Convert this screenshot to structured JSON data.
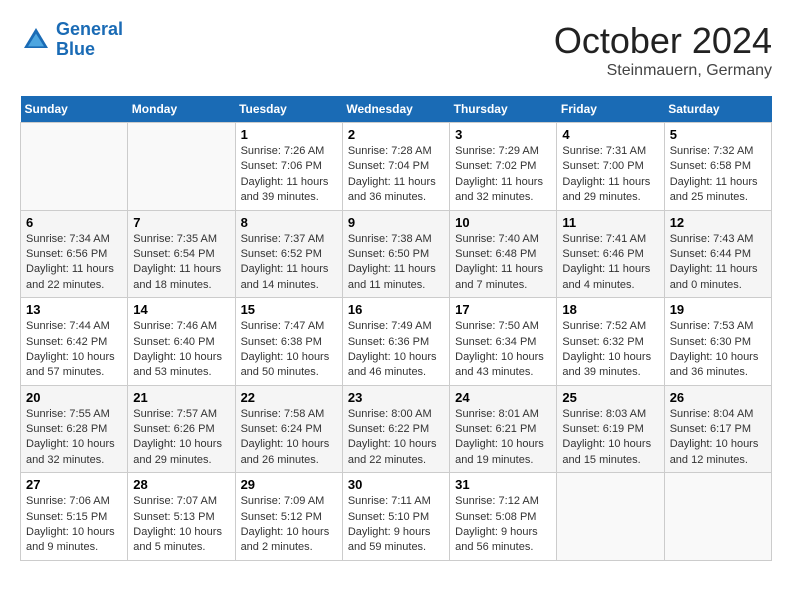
{
  "header": {
    "logo_line1": "General",
    "logo_line2": "Blue",
    "month": "October 2024",
    "location": "Steinmauern, Germany"
  },
  "weekdays": [
    "Sunday",
    "Monday",
    "Tuesday",
    "Wednesday",
    "Thursday",
    "Friday",
    "Saturday"
  ],
  "weeks": [
    [
      {
        "day": "",
        "sunrise": "",
        "sunset": "",
        "daylight": ""
      },
      {
        "day": "",
        "sunrise": "",
        "sunset": "",
        "daylight": ""
      },
      {
        "day": "1",
        "sunrise": "Sunrise: 7:26 AM",
        "sunset": "Sunset: 7:06 PM",
        "daylight": "Daylight: 11 hours and 39 minutes."
      },
      {
        "day": "2",
        "sunrise": "Sunrise: 7:28 AM",
        "sunset": "Sunset: 7:04 PM",
        "daylight": "Daylight: 11 hours and 36 minutes."
      },
      {
        "day": "3",
        "sunrise": "Sunrise: 7:29 AM",
        "sunset": "Sunset: 7:02 PM",
        "daylight": "Daylight: 11 hours and 32 minutes."
      },
      {
        "day": "4",
        "sunrise": "Sunrise: 7:31 AM",
        "sunset": "Sunset: 7:00 PM",
        "daylight": "Daylight: 11 hours and 29 minutes."
      },
      {
        "day": "5",
        "sunrise": "Sunrise: 7:32 AM",
        "sunset": "Sunset: 6:58 PM",
        "daylight": "Daylight: 11 hours and 25 minutes."
      }
    ],
    [
      {
        "day": "6",
        "sunrise": "Sunrise: 7:34 AM",
        "sunset": "Sunset: 6:56 PM",
        "daylight": "Daylight: 11 hours and 22 minutes."
      },
      {
        "day": "7",
        "sunrise": "Sunrise: 7:35 AM",
        "sunset": "Sunset: 6:54 PM",
        "daylight": "Daylight: 11 hours and 18 minutes."
      },
      {
        "day": "8",
        "sunrise": "Sunrise: 7:37 AM",
        "sunset": "Sunset: 6:52 PM",
        "daylight": "Daylight: 11 hours and 14 minutes."
      },
      {
        "day": "9",
        "sunrise": "Sunrise: 7:38 AM",
        "sunset": "Sunset: 6:50 PM",
        "daylight": "Daylight: 11 hours and 11 minutes."
      },
      {
        "day": "10",
        "sunrise": "Sunrise: 7:40 AM",
        "sunset": "Sunset: 6:48 PM",
        "daylight": "Daylight: 11 hours and 7 minutes."
      },
      {
        "day": "11",
        "sunrise": "Sunrise: 7:41 AM",
        "sunset": "Sunset: 6:46 PM",
        "daylight": "Daylight: 11 hours and 4 minutes."
      },
      {
        "day": "12",
        "sunrise": "Sunrise: 7:43 AM",
        "sunset": "Sunset: 6:44 PM",
        "daylight": "Daylight: 11 hours and 0 minutes."
      }
    ],
    [
      {
        "day": "13",
        "sunrise": "Sunrise: 7:44 AM",
        "sunset": "Sunset: 6:42 PM",
        "daylight": "Daylight: 10 hours and 57 minutes."
      },
      {
        "day": "14",
        "sunrise": "Sunrise: 7:46 AM",
        "sunset": "Sunset: 6:40 PM",
        "daylight": "Daylight: 10 hours and 53 minutes."
      },
      {
        "day": "15",
        "sunrise": "Sunrise: 7:47 AM",
        "sunset": "Sunset: 6:38 PM",
        "daylight": "Daylight: 10 hours and 50 minutes."
      },
      {
        "day": "16",
        "sunrise": "Sunrise: 7:49 AM",
        "sunset": "Sunset: 6:36 PM",
        "daylight": "Daylight: 10 hours and 46 minutes."
      },
      {
        "day": "17",
        "sunrise": "Sunrise: 7:50 AM",
        "sunset": "Sunset: 6:34 PM",
        "daylight": "Daylight: 10 hours and 43 minutes."
      },
      {
        "day": "18",
        "sunrise": "Sunrise: 7:52 AM",
        "sunset": "Sunset: 6:32 PM",
        "daylight": "Daylight: 10 hours and 39 minutes."
      },
      {
        "day": "19",
        "sunrise": "Sunrise: 7:53 AM",
        "sunset": "Sunset: 6:30 PM",
        "daylight": "Daylight: 10 hours and 36 minutes."
      }
    ],
    [
      {
        "day": "20",
        "sunrise": "Sunrise: 7:55 AM",
        "sunset": "Sunset: 6:28 PM",
        "daylight": "Daylight: 10 hours and 32 minutes."
      },
      {
        "day": "21",
        "sunrise": "Sunrise: 7:57 AM",
        "sunset": "Sunset: 6:26 PM",
        "daylight": "Daylight: 10 hours and 29 minutes."
      },
      {
        "day": "22",
        "sunrise": "Sunrise: 7:58 AM",
        "sunset": "Sunset: 6:24 PM",
        "daylight": "Daylight: 10 hours and 26 minutes."
      },
      {
        "day": "23",
        "sunrise": "Sunrise: 8:00 AM",
        "sunset": "Sunset: 6:22 PM",
        "daylight": "Daylight: 10 hours and 22 minutes."
      },
      {
        "day": "24",
        "sunrise": "Sunrise: 8:01 AM",
        "sunset": "Sunset: 6:21 PM",
        "daylight": "Daylight: 10 hours and 19 minutes."
      },
      {
        "day": "25",
        "sunrise": "Sunrise: 8:03 AM",
        "sunset": "Sunset: 6:19 PM",
        "daylight": "Daylight: 10 hours and 15 minutes."
      },
      {
        "day": "26",
        "sunrise": "Sunrise: 8:04 AM",
        "sunset": "Sunset: 6:17 PM",
        "daylight": "Daylight: 10 hours and 12 minutes."
      }
    ],
    [
      {
        "day": "27",
        "sunrise": "Sunrise: 7:06 AM",
        "sunset": "Sunset: 5:15 PM",
        "daylight": "Daylight: 10 hours and 9 minutes."
      },
      {
        "day": "28",
        "sunrise": "Sunrise: 7:07 AM",
        "sunset": "Sunset: 5:13 PM",
        "daylight": "Daylight: 10 hours and 5 minutes."
      },
      {
        "day": "29",
        "sunrise": "Sunrise: 7:09 AM",
        "sunset": "Sunset: 5:12 PM",
        "daylight": "Daylight: 10 hours and 2 minutes."
      },
      {
        "day": "30",
        "sunrise": "Sunrise: 7:11 AM",
        "sunset": "Sunset: 5:10 PM",
        "daylight": "Daylight: 9 hours and 59 minutes."
      },
      {
        "day": "31",
        "sunrise": "Sunrise: 7:12 AM",
        "sunset": "Sunset: 5:08 PM",
        "daylight": "Daylight: 9 hours and 56 minutes."
      },
      {
        "day": "",
        "sunrise": "",
        "sunset": "",
        "daylight": ""
      },
      {
        "day": "",
        "sunrise": "",
        "sunset": "",
        "daylight": ""
      }
    ]
  ]
}
